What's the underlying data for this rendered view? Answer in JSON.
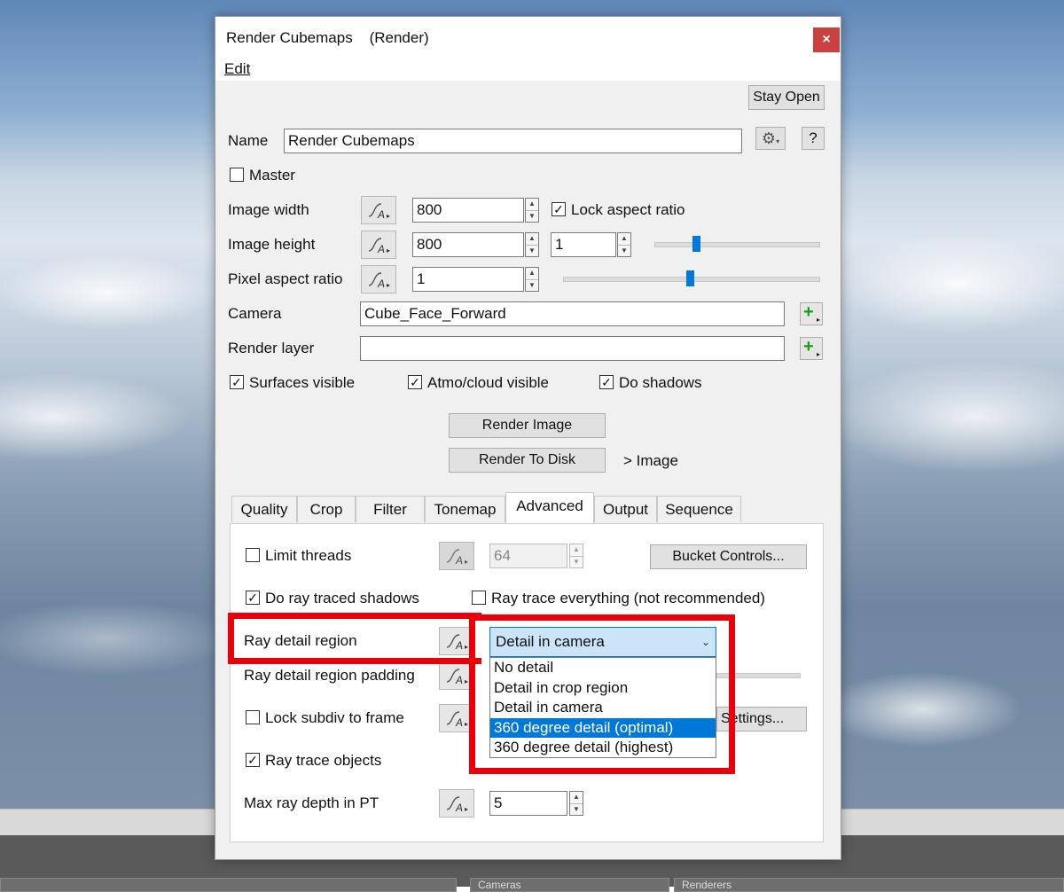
{
  "dialog": {
    "title": "Render Cubemaps    (Render)",
    "close_label": "×",
    "menu_edit": "Edit",
    "stay_open": "Stay Open",
    "help_label": "?",
    "name_label": "Name",
    "name_value": "Render Cubemaps",
    "master_label": "Master",
    "image_width_label": "Image width",
    "image_width_value": "800",
    "lock_aspect_label": "Lock aspect ratio",
    "image_height_label": "Image height",
    "image_height_value": "800",
    "height_ratio_value": "1",
    "pixel_aspect_label": "Pixel aspect ratio",
    "pixel_aspect_value": "1",
    "camera_label": "Camera",
    "camera_value": "Cube_Face_Forward",
    "render_layer_label": "Render layer",
    "render_layer_value": "",
    "surfaces_visible_label": "Surfaces visible",
    "atmo_visible_label": "Atmo/cloud visible",
    "do_shadows_label": "Do shadows",
    "render_image_label": "Render Image",
    "render_to_disk_label": "Render To Disk",
    "render_dest_label": "> Image",
    "tabs": [
      "Quality",
      "Crop",
      "Filter",
      "Tonemap",
      "Advanced",
      "Output",
      "Sequence"
    ],
    "active_tab": "Advanced"
  },
  "advanced": {
    "limit_threads_label": "Limit threads",
    "threads_value": "64",
    "bucket_controls_label": "Bucket Controls...",
    "ray_traced_shadows_label": "Do ray traced shadows",
    "ray_trace_everything_label": "Ray trace everything (not recommended)",
    "ray_detail_region_label": "Ray detail region",
    "ray_detail_region_value": "Detail in camera",
    "ray_detail_padding_label": "Ray detail region padding",
    "lock_subdiv_label": "Lock subdiv to frame",
    "settings_label": "Settings...",
    "ray_trace_objects_label": "Ray trace objects",
    "max_ray_depth_label": "Max ray depth in PT",
    "max_ray_depth_value": "5",
    "dropdown_options": [
      "No detail",
      "Detail in crop region",
      "Detail in camera",
      "360 degree detail (optimal)",
      "360 degree detail (highest)"
    ],
    "dropdown_highlighted": "360 degree detail (optimal)"
  },
  "taskbar": {
    "pane_cameras": "Cameras",
    "pane_renderers": "Renderers"
  },
  "colors": {
    "accent": "#0078d7",
    "highlight_box": "#e8000a",
    "close_button": "#c84040",
    "add_icon": "#1a9c1a"
  }
}
